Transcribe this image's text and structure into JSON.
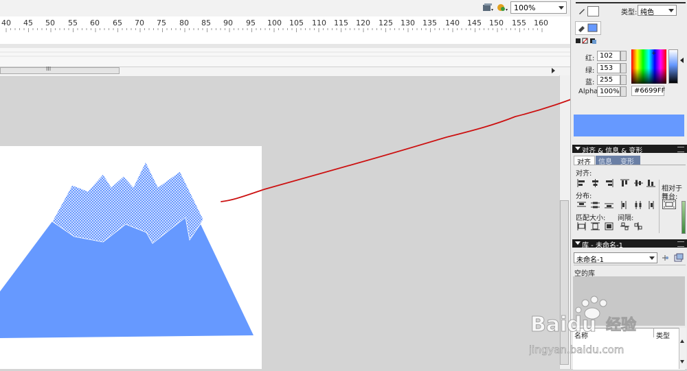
{
  "toolbar": {
    "zoom_value": "100%",
    "icons": [
      "edit-symbol-icon",
      "edit-scene-icon"
    ]
  },
  "ruler": {
    "labels": [
      "40",
      "45",
      "50",
      "55",
      "60",
      "65",
      "70",
      "75",
      "80",
      "85",
      "90",
      "95",
      "100",
      "105",
      "110",
      "115",
      "120",
      "125",
      "130",
      "135",
      "140",
      "145",
      "150",
      "155",
      "160"
    ]
  },
  "timeline": {
    "scroll_grip": "III"
  },
  "color_panel": {
    "type_label": "类型:",
    "type_value": "纯色",
    "red_label": "红:",
    "red_value": "102",
    "green_label": "绿:",
    "green_value": "153",
    "blue_label": "蓝:",
    "blue_value": "255",
    "alpha_label": "Alpha:",
    "alpha_value": "100%",
    "hex_value": "#6699FF",
    "fill_color": "#6699ff"
  },
  "align_panel": {
    "title": "对齐 & 信息 & 变形",
    "tabs": [
      "对齐",
      "信息",
      "变形"
    ],
    "align_label": "对齐:",
    "distribute_label": "分布:",
    "match_size_label": "匹配大小:",
    "spacing_label": "间隔:",
    "relative_label_1": "相对于",
    "relative_label_2": "舞台:"
  },
  "library_panel": {
    "title": "库 - 未命名-1",
    "document_select": "未命名-1",
    "empty_text": "空的库",
    "col_name": "名称",
    "col_type": "类型"
  },
  "watermark": {
    "brand": "Baidu",
    "brand_cn": "经验",
    "url": "jingyan.baidu.com"
  },
  "stage": {
    "mountain_color": "#6699ff",
    "annotation_color": "#cc1111"
  }
}
